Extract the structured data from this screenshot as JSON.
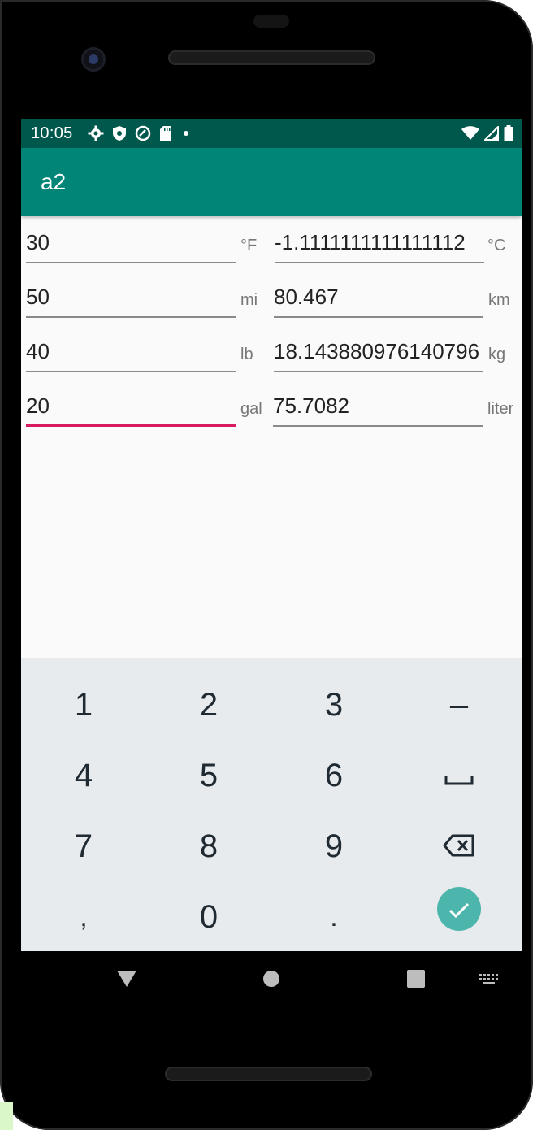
{
  "status_bar": {
    "time": "10:05"
  },
  "app_bar": {
    "title": "a2"
  },
  "rows": [
    {
      "input": "30",
      "input_unit": "°F",
      "output": "-1.1111111111111112",
      "output_unit": "°C"
    },
    {
      "input": "50",
      "input_unit": "mi",
      "output": "80.467",
      "output_unit": "km"
    },
    {
      "input": "40",
      "input_unit": "lb",
      "output": "18.143880976140796",
      "output_unit": "kg"
    },
    {
      "input": "20",
      "input_unit": "gal",
      "output": "75.7082",
      "output_unit": "liter"
    }
  ],
  "keyboard": {
    "keys": [
      "1",
      "2",
      "3",
      "–",
      "4",
      "5",
      "6",
      "7",
      "8",
      "9",
      ",",
      "0",
      "."
    ]
  },
  "colors": {
    "status_bar": "#00574b",
    "app_bar": "#008577",
    "focus_underline": "#d81b60",
    "enter_key": "#4db6ac"
  },
  "icons": {
    "status_left": [
      "gear-icon",
      "shield-icon",
      "vpn-icon",
      "sd-card-icon",
      "dot-icon"
    ],
    "status_right": [
      "wifi-icon",
      "signal-icon",
      "battery-icon"
    ],
    "keyboard_special": [
      "space-icon",
      "backspace-icon",
      "check-icon"
    ],
    "nav": [
      "back-icon",
      "home-icon",
      "recents-icon",
      "keyboard-switch-icon"
    ]
  }
}
